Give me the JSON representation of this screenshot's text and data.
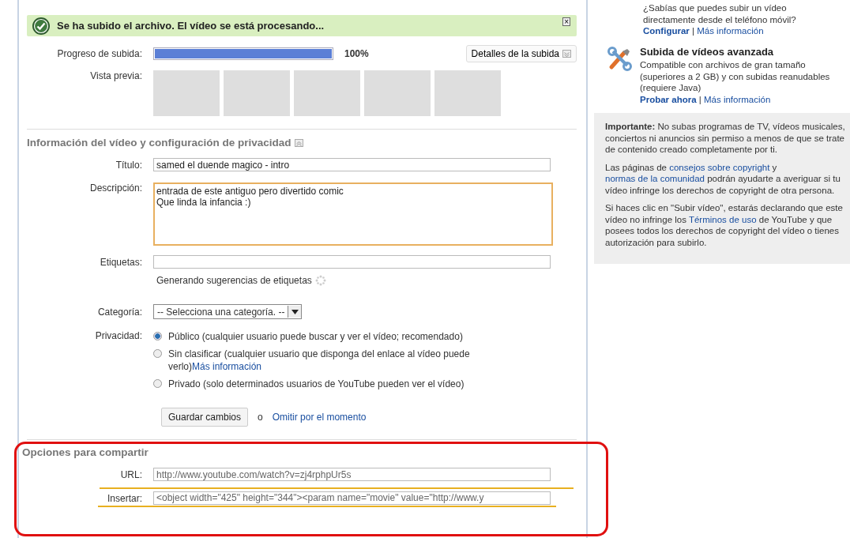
{
  "banner": {
    "message": "Se ha subido el archivo. El vídeo se está procesando...",
    "close": "×"
  },
  "upload": {
    "label": "Progreso de subida:",
    "level": 1,
    "percent": "100%",
    "details_button": "Detalles de la subida"
  },
  "preview": {
    "label": "Vista previa:",
    "thumbnails": [
      {
        "kind": "empty"
      },
      {
        "kind": "empty"
      },
      {
        "kind": "empty"
      },
      {
        "kind": "empty"
      },
      {
        "kind": "empty"
      }
    ]
  },
  "info_section": {
    "title": "Información del vídeo y configuración de privacidad",
    "title_field": {
      "label": "Título:",
      "value": "samed el duende magico - intro"
    },
    "description_field": {
      "label": "Descripción:",
      "lines": [
        "entrada de este antiguo pero divertido comic",
        "Que linda la infancia :)"
      ]
    },
    "tags_field": {
      "label": "Etiquetas:",
      "hint": "Generando sugerencias de etiquetas"
    },
    "category": {
      "label": "Categoría:",
      "value": "-- Selecciona una categoría. --"
    },
    "privacy": {
      "label": "Privacidad:",
      "options": [
        {
          "text": "Público (cualquier usuario puede buscar y ver el vídeo; recomendado)",
          "selected": true
        },
        {
          "text": "Sin clasificar (cualquier usuario que disponga del enlace al vídeo puede verlo)",
          "link": "Más información",
          "selected": false
        },
        {
          "text": "Privado (solo determinados usuarios de YouTube pueden ver el vídeo)",
          "selected": false
        }
      ]
    },
    "save_button": "Guardar cambios",
    "or": "o",
    "skip_link": "Omitir por el momento"
  },
  "share_section": {
    "title": "Opciones para compartir",
    "url": {
      "label": "URL:",
      "value": "http://www.youtube.com/watch?v=zj4rphpUr5s"
    },
    "embed": {
      "label": "Insertar:",
      "value": "<object width=\"425\" height=\"344\"><param name=\"movie\" value=\"http://www.y"
    }
  },
  "sidebar": {
    "mobile": {
      "lines": [
        "¿Sabías que puedes subir un vídeo",
        "directamente desde el teléfono móvil?"
      ],
      "links": [
        "Configurar",
        "Más información"
      ],
      "separator": "|"
    },
    "advanced": {
      "title": "Subida de vídeos avanzada",
      "text": "Compatible con archivos de gran tamaño (superiores a 2 GB) y con subidas reanudables (requiere Java)",
      "links": [
        "Probar ahora",
        "Más información"
      ],
      "separator": "|"
    },
    "notice": [
      "**Importante:** No subas programas de TV, vídeos musicales, conciertos ni anuncios sin permiso a menos de que se trate de contenido creado completamente por ti."
    ],
    "copyright": {
      "before": "Las páginas de ",
      "link1": "consejos sobre copyright",
      "middle": " y ",
      "link2": "normas de la comunidad",
      "after": " podrán ayudarte a averiguar si tu vídeo infringe los derechos de copyright de otra persona."
    },
    "terms": {
      "before": "Si haces clic en \"Subir vídeo\", estarás declarando que este vídeo no infringe los ",
      "link": "Términos de uso",
      "after": " de YouTube y que posees todos los derechos de copyright del vídeo o tienes autorización para subirlo."
    }
  }
}
